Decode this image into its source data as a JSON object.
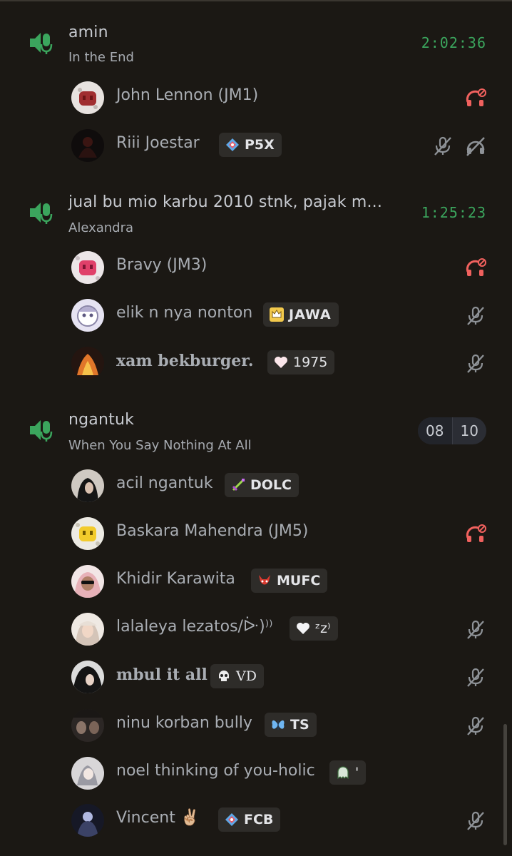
{
  "channels": [
    {
      "name": "amin",
      "subtitle": "In the End",
      "timer": "2:02:36",
      "members": [
        {
          "name": "John Lennon (JM1)",
          "status": "deafened"
        },
        {
          "name": "Riii Joestar",
          "tag": "P5X",
          "status": "muted-deafened"
        }
      ]
    },
    {
      "name": "jual bu mio karbu 2010 stnk, pajak m...",
      "subtitle": "Alexandra",
      "timer": "1:25:23",
      "members": [
        {
          "name": "Bravy (JM3)",
          "status": "deafened"
        },
        {
          "name": "elik n nya nonton",
          "tag": "JAWA",
          "status": "muted"
        },
        {
          "name": "xam bekburger.",
          "tag": "1975",
          "status": "muted"
        }
      ]
    },
    {
      "name": "ngantuk",
      "subtitle": "When You Say Nothing At All",
      "user_limit": {
        "current": "08",
        "max": "10"
      },
      "members": [
        {
          "name": "acil ngantuk",
          "tag": "DOLC",
          "status": "none"
        },
        {
          "name": "Baskara Mahendra (JM5)",
          "status": "deafened"
        },
        {
          "name": "Khidir Karawita",
          "tag": "MUFC",
          "status": "none"
        },
        {
          "name": "lalaleya lezatos/ᐕ)⁾⁾",
          "tag": "ᶻz⁾",
          "status": "muted"
        },
        {
          "name": "mbul it all",
          "tag": "VD",
          "status": "muted"
        },
        {
          "name": "ninu korban bully",
          "tag": "TS",
          "status": "muted"
        },
        {
          "name": "noel thinking of you-holic",
          "tag": "'",
          "status": "none"
        },
        {
          "name": "Vincent ✌🏼",
          "tag": "FCB",
          "status": "muted"
        }
      ]
    }
  ],
  "colors": {
    "background": "#1b1814",
    "voice_green": "#3ba55d",
    "deafened_red": "#f0615e",
    "muted_gray": "#8e9297"
  }
}
